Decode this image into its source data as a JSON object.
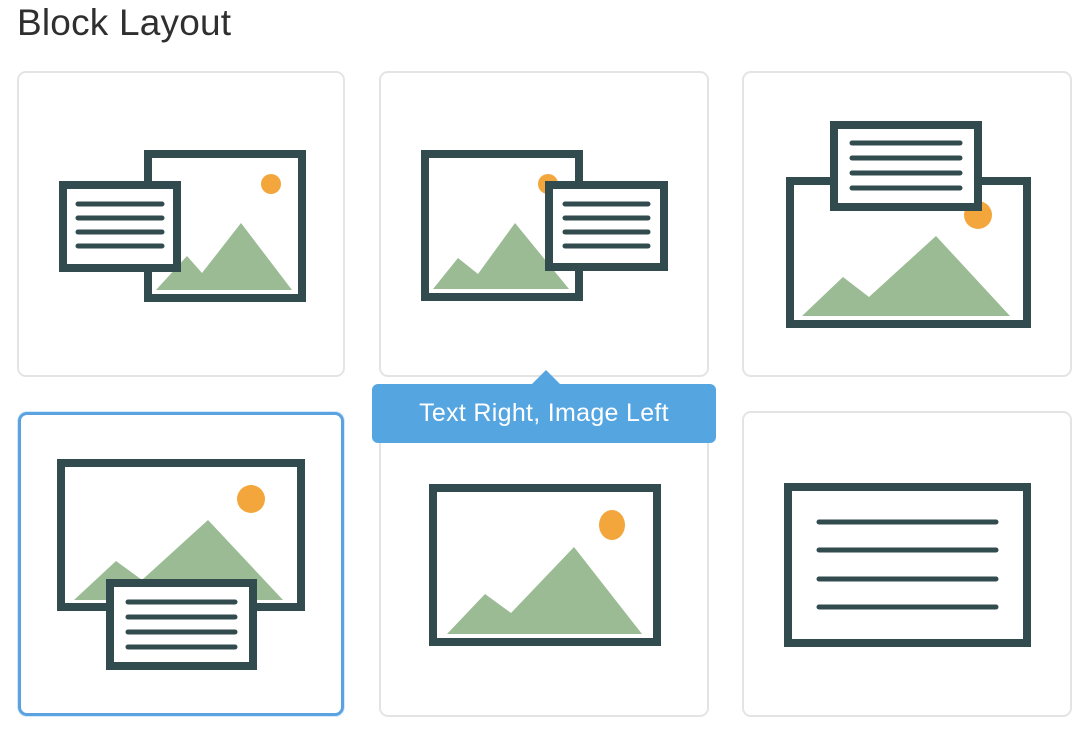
{
  "header": {
    "title": "Block Layout"
  },
  "tooltip": {
    "text": "Text Right, Image Left"
  },
  "colors": {
    "stroke": "#324b4e",
    "mountain": "#9abb93",
    "sun": "#f2a63c",
    "selected_border": "#5aa3e0",
    "tooltip_bg": "#55a5e1"
  },
  "layouts": [
    {
      "icon": "text-left-image-right-icon"
    },
    {
      "icon": "text-right-image-left-icon"
    },
    {
      "icon": "text-top-image-bottom-icon"
    },
    {
      "icon": "text-bottom-image-top-icon",
      "selected": true
    },
    {
      "icon": "image-only-icon"
    },
    {
      "icon": "text-only-icon"
    }
  ]
}
